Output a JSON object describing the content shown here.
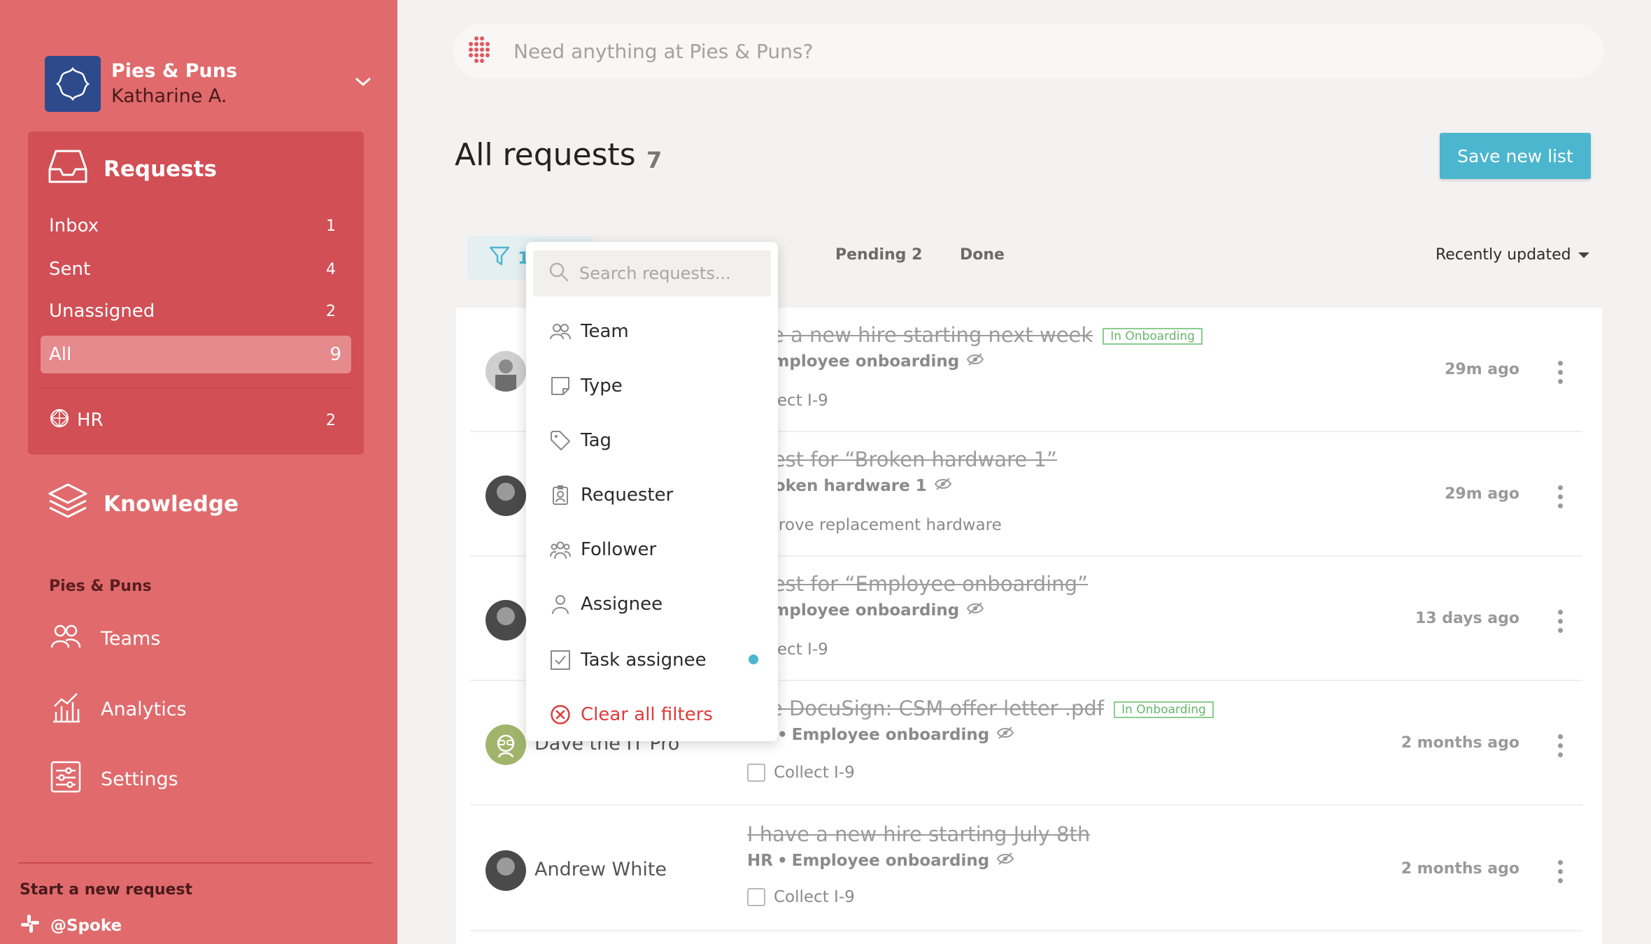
{
  "workspace": {
    "name": "Pies & Puns",
    "user": "Katharine A."
  },
  "requests_nav": {
    "title": "Requests",
    "items": [
      {
        "label": "Inbox",
        "count": "1"
      },
      {
        "label": "Sent",
        "count": "4"
      },
      {
        "label": "Unassigned",
        "count": "2"
      },
      {
        "label": "All",
        "count": "9"
      }
    ],
    "teams": [
      {
        "label": "HR",
        "count": "2"
      }
    ]
  },
  "knowledge": {
    "title": "Knowledge"
  },
  "org_section": {
    "label": "Pies & Puns",
    "links": [
      "Teams",
      "Analytics",
      "Settings"
    ]
  },
  "footer": {
    "start_request": "Start a new request",
    "slack_handle": "@Spoke"
  },
  "search": {
    "placeholder": "Need anything at Pies & Puns?"
  },
  "header": {
    "title": "All requests",
    "count": "7",
    "save_button": "Save new list"
  },
  "tabs": {
    "filter_count": "1",
    "items": [
      {
        "label": "Pending 2"
      },
      {
        "label": "Done"
      }
    ],
    "sort_label": "Recently updated"
  },
  "requests": [
    {
      "requester": "",
      "title": "ave a new hire starting next week",
      "badge": "In Onboarding",
      "team": "",
      "type": "Employee onboarding",
      "task": "Collect I-9",
      "time": "29m ago"
    },
    {
      "requester": "",
      "title": "quest for “Broken hardware 1”",
      "badge": "",
      "team": "",
      "type": "Broken hardware 1",
      "task": "Approve replacement hardware",
      "time": "29m ago"
    },
    {
      "requester": "",
      "title": "quest for “Employee onboarding”",
      "badge": "",
      "team": "",
      "type": "Employee onboarding",
      "task": "Collect I-9",
      "time": "13 days ago"
    },
    {
      "requester": "Dave the IT Pro",
      "title": "ase DocuSign: CSM offer letter .pdf",
      "badge": "In Onboarding",
      "team": "HR",
      "type": "Employee onboarding",
      "task": "Collect I-9",
      "time": "2 months ago"
    },
    {
      "requester": "Andrew White",
      "title": "I have a new hire starting July 8th",
      "badge": "",
      "team": "HR",
      "type": "Employee onboarding",
      "task": "Collect I-9",
      "time": "2 months ago"
    }
  ],
  "filter_dropdown": {
    "search_placeholder": "Search requests...",
    "options": [
      "Team",
      "Type",
      "Tag",
      "Requester",
      "Follower",
      "Assignee",
      "Task assignee"
    ],
    "clear_label": "Clear all filters",
    "active_option": "Task assignee"
  },
  "colors": {
    "sidebar": "#e06a6c",
    "sidebar_panel": "#d14f55",
    "accent": "#4cb6cf",
    "danger": "#e03b3b",
    "badge_green": "#67b56a"
  }
}
